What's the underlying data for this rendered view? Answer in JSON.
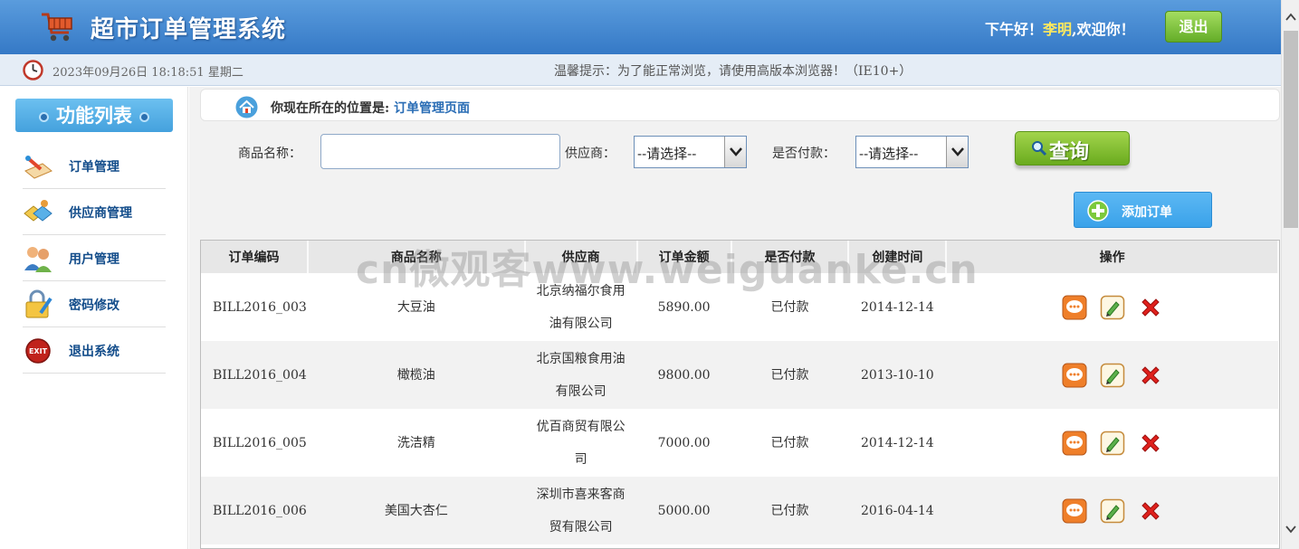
{
  "header": {
    "title": "超市订单管理系统",
    "greeting_prefix": "下午好！",
    "user_name": "李明",
    "greeting_suffix": ",欢迎你！",
    "logout_label": "退出"
  },
  "status": {
    "datetime": "2023年09月26日 18:18:51 星期二",
    "tip": "温馨提示：为了能正常浏览，请使用高版本浏览器！（IE10+）"
  },
  "sidebar": {
    "title": "功能列表",
    "items": [
      {
        "label": "订单管理",
        "icon": "order-icon"
      },
      {
        "label": "供应商管理",
        "icon": "supplier-icon"
      },
      {
        "label": "用户管理",
        "icon": "users-icon"
      },
      {
        "label": "密码修改",
        "icon": "lock-icon"
      },
      {
        "label": "退出系统",
        "icon": "exit-icon"
      }
    ]
  },
  "location": {
    "prefix": "你现在所在的位置是:",
    "page": "订单管理页面"
  },
  "search": {
    "product_label": "商品名称：",
    "product_value": "",
    "supplier_label": "供应商：",
    "supplier_value": "--请选择--",
    "paid_label": "是否付款：",
    "paid_value": "--请选择--",
    "query_label": "查询"
  },
  "add_button": "添加订单",
  "table": {
    "headers": [
      "订单编码",
      "商品名称",
      "供应商",
      "订单金额",
      "是否付款",
      "创建时间",
      "操作"
    ],
    "rows": [
      {
        "code": "BILL2016_003",
        "product": "大豆油",
        "supplier_l1": "北京纳福尔食用",
        "supplier_l2": "油有限公司",
        "amount": "5890.00",
        "paid": "已付款",
        "date": "2014-12-14"
      },
      {
        "code": "BILL2016_004",
        "product": "橄榄油",
        "supplier_l1": "北京国粮食用油",
        "supplier_l2": "有限公司",
        "amount": "9800.00",
        "paid": "已付款",
        "date": "2013-10-10"
      },
      {
        "code": "BILL2016_005",
        "product": "洗洁精",
        "supplier_l1": "优百商贸有限公",
        "supplier_l2": "司",
        "amount": "7000.00",
        "paid": "已付款",
        "date": "2014-12-14"
      },
      {
        "code": "BILL2016_006",
        "product": "美国大杏仁",
        "supplier_l1": "深圳市喜来客商",
        "supplier_l2": "贸有限公司",
        "amount": "5000.00",
        "paid": "已付款",
        "date": "2016-04-14"
      }
    ]
  },
  "watermark": "cn微观客www.weiguanke.cn"
}
